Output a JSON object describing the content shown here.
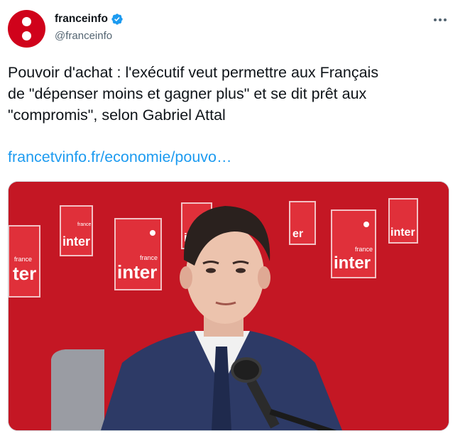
{
  "account": {
    "display_name": "franceinfo",
    "handle": "@franceinfo",
    "verified": true,
    "avatar_color": "#d0021b"
  },
  "tweet": {
    "text": "Pouvoir d'achat : l'exécutif veut permettre aux Français\nde \"dépenser moins et gagner plus\" et se dit prêt aux\n\"compromis\", selon Gabriel Attal",
    "link": "francetvinfo.fr/economie/pouvo…"
  },
  "media": {
    "logo_small": "france",
    "logo_big": "inter",
    "background_color": "#c81a26"
  },
  "icons": {
    "more": "more-options-icon",
    "verified": "verified-badge-icon"
  },
  "colors": {
    "link": "#1d9bf0",
    "verified": "#1d9bf0",
    "text": "#0f1419",
    "secondary": "#536471"
  }
}
